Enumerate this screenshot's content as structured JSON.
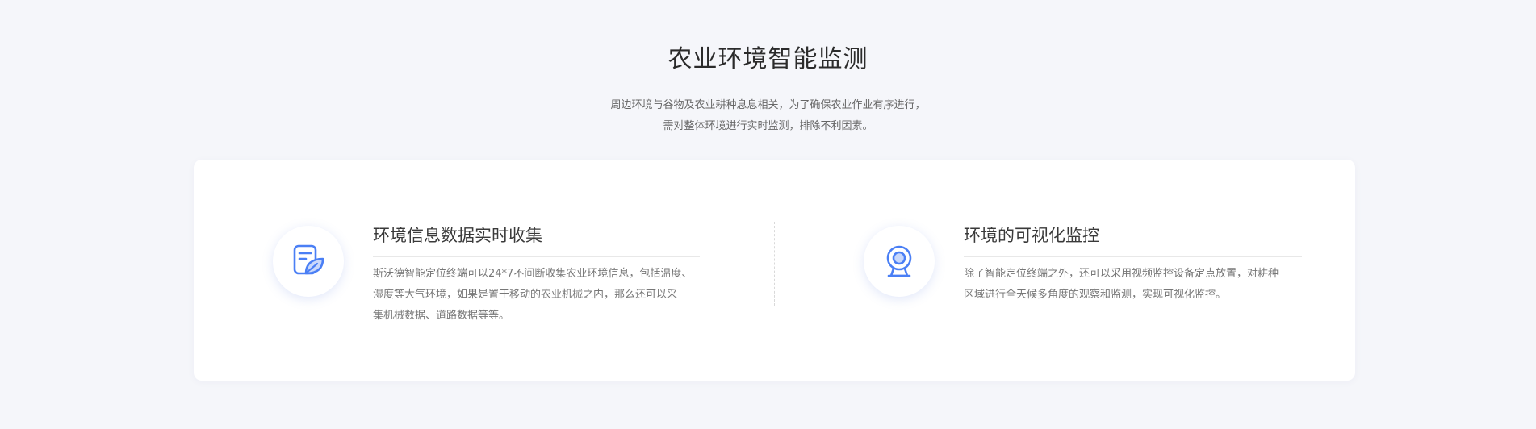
{
  "section": {
    "title": "农业环境智能监测",
    "desc_lines": [
      "周边环境与谷物及农业耕种息息相关，为了确保农业作业有序进行，",
      "需对整体环境进行实时监测，排除不利因素。"
    ]
  },
  "features": [
    {
      "icon": "document-leaf-icon",
      "title": "环境信息数据实时收集",
      "desc_lines": [
        "斯沃德智能定位终端可以24*7不间断收集农业环境信息，包括温度、",
        "湿度等大气环境，如果是置于移动的农业机械之内，那么还可以采",
        "集机械数据、道路数据等等。"
      ]
    },
    {
      "icon": "webcam-icon",
      "title": "环境的可视化监控",
      "desc_lines": [
        "除了智能定位终端之外，还可以采用视频监控设备定点放置，对耕种",
        "区域进行全天候多角度的观察和监测，实现可视化监控。"
      ]
    }
  ],
  "colors": {
    "accent": "#4a7ff5",
    "accent_light": "#c9d8fb",
    "background": "#f5f6fa"
  }
}
